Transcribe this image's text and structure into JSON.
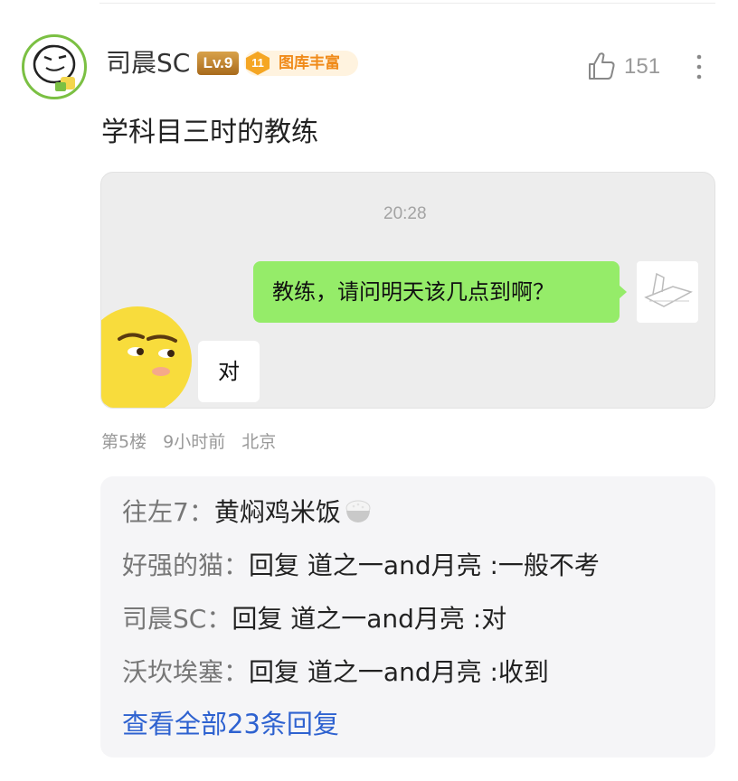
{
  "post": {
    "username": "司晨SC",
    "level": "Lv.9",
    "honor_badge_num": "11",
    "honor_badge_label": "图库丰富",
    "like_count": "151",
    "text": "学科目三时的教练",
    "meta": {
      "floor": "第5楼",
      "time": "9小时前",
      "location": "北京"
    }
  },
  "chat_image": {
    "time": "20:28",
    "message_right": "教练，请问明天该几点到啊？",
    "message_left": "对"
  },
  "replies": {
    "items": [
      {
        "author": "往左7：",
        "text": "黄焖鸡米饭"
      },
      {
        "author": "好强的猫：",
        "text": "回复 道之一and月亮 :一般不考"
      },
      {
        "author": "司晨SC：",
        "text": "回复 道之一and月亮 :对"
      },
      {
        "author": "沃坎埃塞：",
        "text": "回复 道之一and月亮 :收到"
      }
    ],
    "view_all": "查看全部23条回复"
  },
  "icons": {
    "like": "thumbs-up-icon",
    "more": "more-vertical-icon",
    "rice": "rice-bowl-icon"
  },
  "colors": {
    "accent_link": "#2e62d0",
    "chat_bubble_green": "#95ec69",
    "honor_orange": "#f08b1a",
    "level_gold": "#c08a3a"
  }
}
